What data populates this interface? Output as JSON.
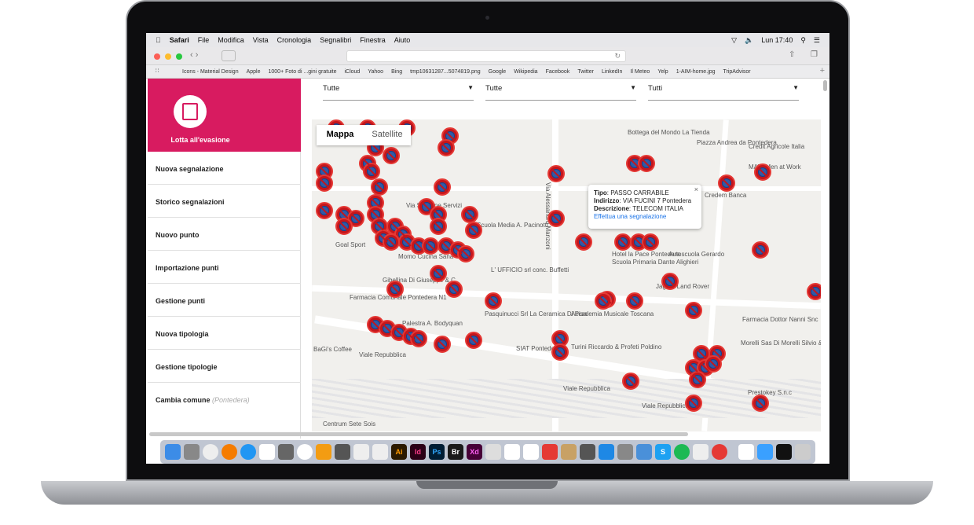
{
  "menubar": {
    "app": "Safari",
    "items": [
      "File",
      "Modifica",
      "Vista",
      "Cronologia",
      "Segnalibri",
      "Finestra",
      "Aiuto"
    ],
    "clock": "Lun 17:40"
  },
  "bookmarks": [
    "Icons - Material Design",
    "Apple",
    "1000+ Foto di ...gini gratuite",
    "iCloud",
    "Yahoo",
    "Bing",
    "tmp10631287...5074819.png",
    "Google",
    "Wikipedia",
    "Facebook",
    "Twitter",
    "LinkedIn",
    "Il Meteo",
    "Yelp",
    "1-AIM-home.jpg",
    "TripAdvisor"
  ],
  "sidebar": {
    "title": "Lotta all'evasione",
    "items": [
      "Nuova segnalazione",
      "Storico segnalazioni",
      "Nuovo punto",
      "Importazione punti",
      "Gestione punti",
      "Nuova tipologia",
      "Gestione tipologie",
      "Cambia comune"
    ],
    "comune": "(Pontedera)",
    "accent": "#d81b60"
  },
  "filters": [
    "Tutte",
    "Tutte",
    "Tutti"
  ],
  "map": {
    "tabs": [
      "Mappa",
      "Satellite"
    ],
    "labels": [
      "Bottega del Mondo La Tienda",
      "Piazza Andrea da Pontedera",
      "Credit Agricole Italia",
      "MAW Men at Work",
      "Credem Banca",
      "Autoscuola Gerardo",
      "Hotel la Pace Pontedera",
      "Scuola Primaria Dante Alighieri",
      "Jaguar Land Rover",
      "Goal Sport",
      "Momo Cucina Sana",
      "Scuola Media A. Pacinotti",
      "L' UFFICIO srl conc. Buffetti",
      "Farmacia Comunale Pontedera N1",
      "Palestra A. Bodyquan",
      "Pasquinucci Srl La Ceramica Di Pisa",
      "Accademia Musicale Toscana",
      "Turini Riccardo & Profeti Poldino",
      "SIAT Pontedera",
      "Viale Repubblica",
      "Viale Repubblica",
      "Viale Repubblica",
      "Farmacia Dottor Nanni Snc",
      "Morelli Sas Di Morelli Silvio & C",
      "Prestokey S.n.c",
      "Centrum Sete Sois",
      "BaGi's Coffee",
      "Via Alessandro Manzoni",
      "Via Stazione Servizi",
      "Gibellina Di Giuseppe & C."
    ],
    "popup": {
      "tipo_label": "Tipo",
      "tipo": "PASSO CARRABILE",
      "indirizzo_label": "Indirizzo",
      "indirizzo": "VIA FUCINI 7 Pontedera",
      "descrizione_label": "Descrizione",
      "descrizione": "TELECOM ITALIA",
      "link": "Effettua una segnalazione"
    },
    "marker_color": "#c4161c"
  },
  "dock": [
    "Ai",
    "Id",
    "Ps",
    "Br",
    "Xd",
    "S"
  ]
}
